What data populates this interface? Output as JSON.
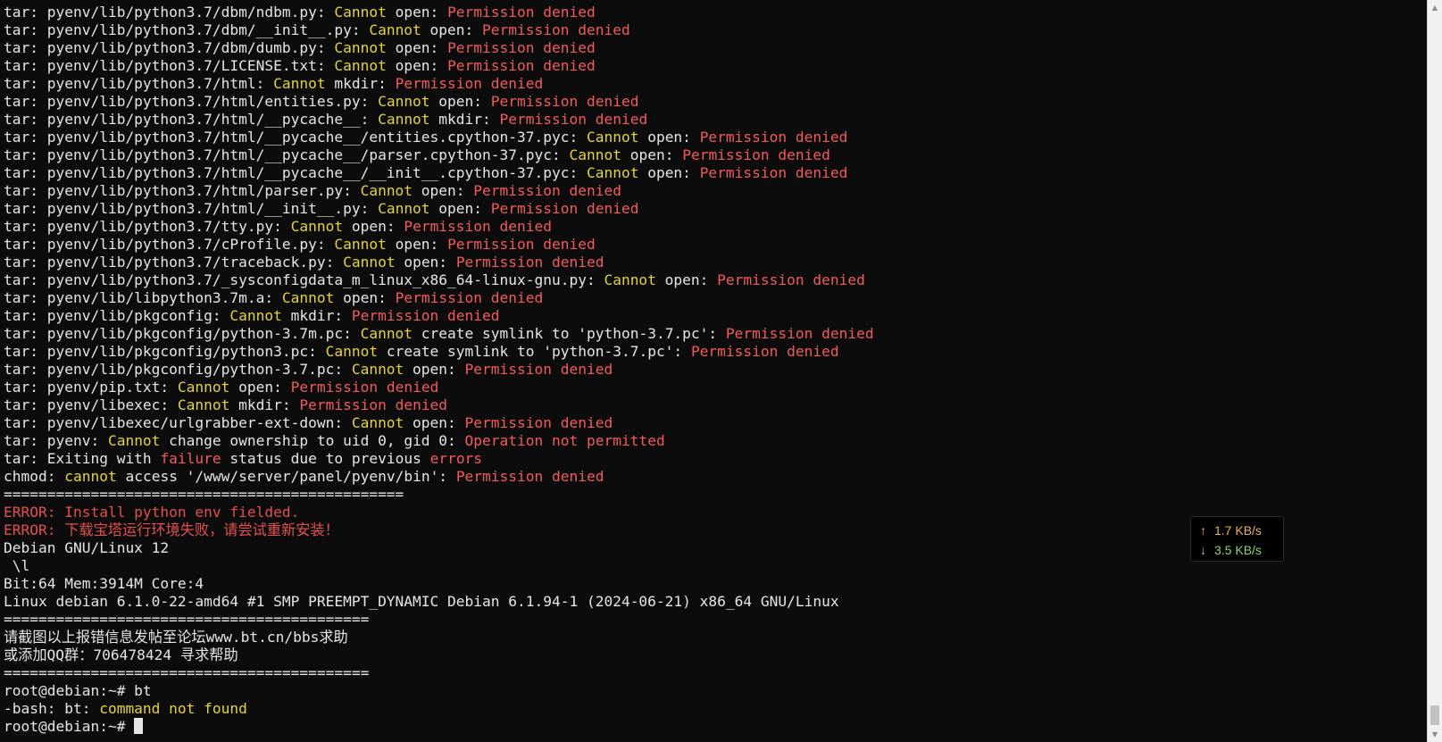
{
  "terminal": {
    "colors": {
      "background": "#0c0c0c",
      "default_text": "#e6e6e6",
      "highlight_yellow": "#e5d33f",
      "error_red": "#f25b5b"
    },
    "lines": [
      [
        {
          "t": "tar: pyenv/lib/python3.7/dbm/ndbm.py: ",
          "c": "default"
        },
        {
          "t": "Cannot",
          "c": "yellow"
        },
        {
          "t": " open: ",
          "c": "default"
        },
        {
          "t": "Permission denied",
          "c": "red"
        }
      ],
      [
        {
          "t": "tar: pyenv/lib/python3.7/dbm/__init__.py: ",
          "c": "default"
        },
        {
          "t": "Cannot",
          "c": "yellow"
        },
        {
          "t": " open: ",
          "c": "default"
        },
        {
          "t": "Permission denied",
          "c": "red"
        }
      ],
      [
        {
          "t": "tar: pyenv/lib/python3.7/dbm/dumb.py: ",
          "c": "default"
        },
        {
          "t": "Cannot",
          "c": "yellow"
        },
        {
          "t": " open: ",
          "c": "default"
        },
        {
          "t": "Permission denied",
          "c": "red"
        }
      ],
      [
        {
          "t": "tar: pyenv/lib/python3.7/LICENSE.txt: ",
          "c": "default"
        },
        {
          "t": "Cannot",
          "c": "yellow"
        },
        {
          "t": " open: ",
          "c": "default"
        },
        {
          "t": "Permission denied",
          "c": "red"
        }
      ],
      [
        {
          "t": "tar: pyenv/lib/python3.7/html: ",
          "c": "default"
        },
        {
          "t": "Cannot",
          "c": "yellow"
        },
        {
          "t": " mkdir: ",
          "c": "default"
        },
        {
          "t": "Permission denied",
          "c": "red"
        }
      ],
      [
        {
          "t": "tar: pyenv/lib/python3.7/html/entities.py: ",
          "c": "default"
        },
        {
          "t": "Cannot",
          "c": "yellow"
        },
        {
          "t": " open: ",
          "c": "default"
        },
        {
          "t": "Permission denied",
          "c": "red"
        }
      ],
      [
        {
          "t": "tar: pyenv/lib/python3.7/html/__pycache__: ",
          "c": "default"
        },
        {
          "t": "Cannot",
          "c": "yellow"
        },
        {
          "t": " mkdir: ",
          "c": "default"
        },
        {
          "t": "Permission denied",
          "c": "red"
        }
      ],
      [
        {
          "t": "tar: pyenv/lib/python3.7/html/__pycache__/entities.cpython-37.pyc: ",
          "c": "default"
        },
        {
          "t": "Cannot",
          "c": "yellow"
        },
        {
          "t": " open: ",
          "c": "default"
        },
        {
          "t": "Permission denied",
          "c": "red"
        }
      ],
      [
        {
          "t": "tar: pyenv/lib/python3.7/html/__pycache__/parser.cpython-37.pyc: ",
          "c": "default"
        },
        {
          "t": "Cannot",
          "c": "yellow"
        },
        {
          "t": " open: ",
          "c": "default"
        },
        {
          "t": "Permission denied",
          "c": "red"
        }
      ],
      [
        {
          "t": "tar: pyenv/lib/python3.7/html/__pycache__/__init__.cpython-37.pyc: ",
          "c": "default"
        },
        {
          "t": "Cannot",
          "c": "yellow"
        },
        {
          "t": " open: ",
          "c": "default"
        },
        {
          "t": "Permission denied",
          "c": "red"
        }
      ],
      [
        {
          "t": "tar: pyenv/lib/python3.7/html/parser.py: ",
          "c": "default"
        },
        {
          "t": "Cannot",
          "c": "yellow"
        },
        {
          "t": " open: ",
          "c": "default"
        },
        {
          "t": "Permission denied",
          "c": "red"
        }
      ],
      [
        {
          "t": "tar: pyenv/lib/python3.7/html/__init__.py: ",
          "c": "default"
        },
        {
          "t": "Cannot",
          "c": "yellow"
        },
        {
          "t": " open: ",
          "c": "default"
        },
        {
          "t": "Permission denied",
          "c": "red"
        }
      ],
      [
        {
          "t": "tar: pyenv/lib/python3.7/tty.py: ",
          "c": "default"
        },
        {
          "t": "Cannot",
          "c": "yellow"
        },
        {
          "t": " open: ",
          "c": "default"
        },
        {
          "t": "Permission denied",
          "c": "red"
        }
      ],
      [
        {
          "t": "tar: pyenv/lib/python3.7/cProfile.py: ",
          "c": "default"
        },
        {
          "t": "Cannot",
          "c": "yellow"
        },
        {
          "t": " open: ",
          "c": "default"
        },
        {
          "t": "Permission denied",
          "c": "red"
        }
      ],
      [
        {
          "t": "tar: pyenv/lib/python3.7/traceback.py: ",
          "c": "default"
        },
        {
          "t": "Cannot",
          "c": "yellow"
        },
        {
          "t": " open: ",
          "c": "default"
        },
        {
          "t": "Permission denied",
          "c": "red"
        }
      ],
      [
        {
          "t": "tar: pyenv/lib/python3.7/_sysconfigdata_m_linux_x86_64-linux-gnu.py: ",
          "c": "default"
        },
        {
          "t": "Cannot",
          "c": "yellow"
        },
        {
          "t": " open: ",
          "c": "default"
        },
        {
          "t": "Permission denied",
          "c": "red"
        }
      ],
      [
        {
          "t": "tar: pyenv/lib/libpython3.7m.a: ",
          "c": "default"
        },
        {
          "t": "Cannot",
          "c": "yellow"
        },
        {
          "t": " open: ",
          "c": "default"
        },
        {
          "t": "Permission denied",
          "c": "red"
        }
      ],
      [
        {
          "t": "tar: pyenv/lib/pkgconfig: ",
          "c": "default"
        },
        {
          "t": "Cannot",
          "c": "yellow"
        },
        {
          "t": " mkdir: ",
          "c": "default"
        },
        {
          "t": "Permission denied",
          "c": "red"
        }
      ],
      [
        {
          "t": "tar: pyenv/lib/pkgconfig/python-3.7m.pc: ",
          "c": "default"
        },
        {
          "t": "Cannot",
          "c": "yellow"
        },
        {
          "t": " create symlink to 'python-3.7.pc': ",
          "c": "default"
        },
        {
          "t": "Permission denied",
          "c": "red"
        }
      ],
      [
        {
          "t": "tar: pyenv/lib/pkgconfig/python3.pc: ",
          "c": "default"
        },
        {
          "t": "Cannot",
          "c": "yellow"
        },
        {
          "t": " create symlink to 'python-3.7.pc': ",
          "c": "default"
        },
        {
          "t": "Permission denied",
          "c": "red"
        }
      ],
      [
        {
          "t": "tar: pyenv/lib/pkgconfig/python-3.7.pc: ",
          "c": "default"
        },
        {
          "t": "Cannot",
          "c": "yellow"
        },
        {
          "t": " open: ",
          "c": "default"
        },
        {
          "t": "Permission denied",
          "c": "red"
        }
      ],
      [
        {
          "t": "tar: pyenv/pip.txt: ",
          "c": "default"
        },
        {
          "t": "Cannot",
          "c": "yellow"
        },
        {
          "t": " open: ",
          "c": "default"
        },
        {
          "t": "Permission denied",
          "c": "red"
        }
      ],
      [
        {
          "t": "tar: pyenv/libexec: ",
          "c": "default"
        },
        {
          "t": "Cannot",
          "c": "yellow"
        },
        {
          "t": " mkdir: ",
          "c": "default"
        },
        {
          "t": "Permission denied",
          "c": "red"
        }
      ],
      [
        {
          "t": "tar: pyenv/libexec/urlgrabber-ext-down: ",
          "c": "default"
        },
        {
          "t": "Cannot",
          "c": "yellow"
        },
        {
          "t": " open: ",
          "c": "default"
        },
        {
          "t": "Permission denied",
          "c": "red"
        }
      ],
      [
        {
          "t": "tar: pyenv: ",
          "c": "default"
        },
        {
          "t": "Cannot",
          "c": "yellow"
        },
        {
          "t": " change ownership to uid 0, gid 0: ",
          "c": "default"
        },
        {
          "t": "Operation not permitted",
          "c": "red"
        }
      ],
      [
        {
          "t": "tar: Exiting with ",
          "c": "default"
        },
        {
          "t": "failure",
          "c": "red"
        },
        {
          "t": " status due to previous ",
          "c": "default"
        },
        {
          "t": "errors",
          "c": "red"
        }
      ],
      [
        {
          "t": "chmod: ",
          "c": "default"
        },
        {
          "t": "cannot",
          "c": "yellow"
        },
        {
          "t": " access '/www/server/panel/pyenv/bin': ",
          "c": "default"
        },
        {
          "t": "Permission denied",
          "c": "red"
        }
      ],
      [
        {
          "t": "==============================================",
          "c": "default"
        }
      ],
      [
        {
          "t": "ERROR: Install python env fielded.",
          "c": "err"
        }
      ],
      [
        {
          "t": "ERROR: 下载宝塔运行环境失败，请尝试重新安装！",
          "c": "err"
        }
      ],
      [
        {
          "t": "Debian GNU/Linux 12",
          "c": "default"
        }
      ],
      [
        {
          "t": " \\l",
          "c": "default"
        }
      ],
      [
        {
          "t": "Bit:64 Mem:3914M Core:4",
          "c": "default"
        }
      ],
      [
        {
          "t": "Linux debian 6.1.0-22-amd64 #1 SMP PREEMPT_DYNAMIC Debian 6.1.94-1 (2024-06-21) x86_64 GNU/Linux",
          "c": "default"
        }
      ],
      [
        {
          "t": "==========================================",
          "c": "default"
        }
      ],
      [
        {
          "t": "请截图以上报错信息发帖至论坛www.bt.cn/bbs求助",
          "c": "default"
        }
      ],
      [
        {
          "t": "或添加QQ群：706478424 寻求帮助",
          "c": "default"
        }
      ],
      [
        {
          "t": "==========================================",
          "c": "default"
        }
      ],
      [
        {
          "t": "root@debian:~# bt",
          "c": "default"
        }
      ],
      [
        {
          "t": "-bash: bt: ",
          "c": "default"
        },
        {
          "t": "command not found",
          "c": "yellow"
        }
      ],
      [
        {
          "t": "root@debian:~# ",
          "c": "default"
        }
      ]
    ]
  },
  "net_speed": {
    "upload_arrow": "↑",
    "upload": "1.7 KB/s",
    "download_arrow": "↓",
    "download": "3.5 KB/s",
    "upload_color": "#e8b64c",
    "download_color": "#8ed36a"
  },
  "scrollbar": {
    "up_icon": "▲",
    "down_icon": "▼",
    "icon_names": [
      "arrow-up-icon",
      "arrow-down-icon"
    ]
  }
}
